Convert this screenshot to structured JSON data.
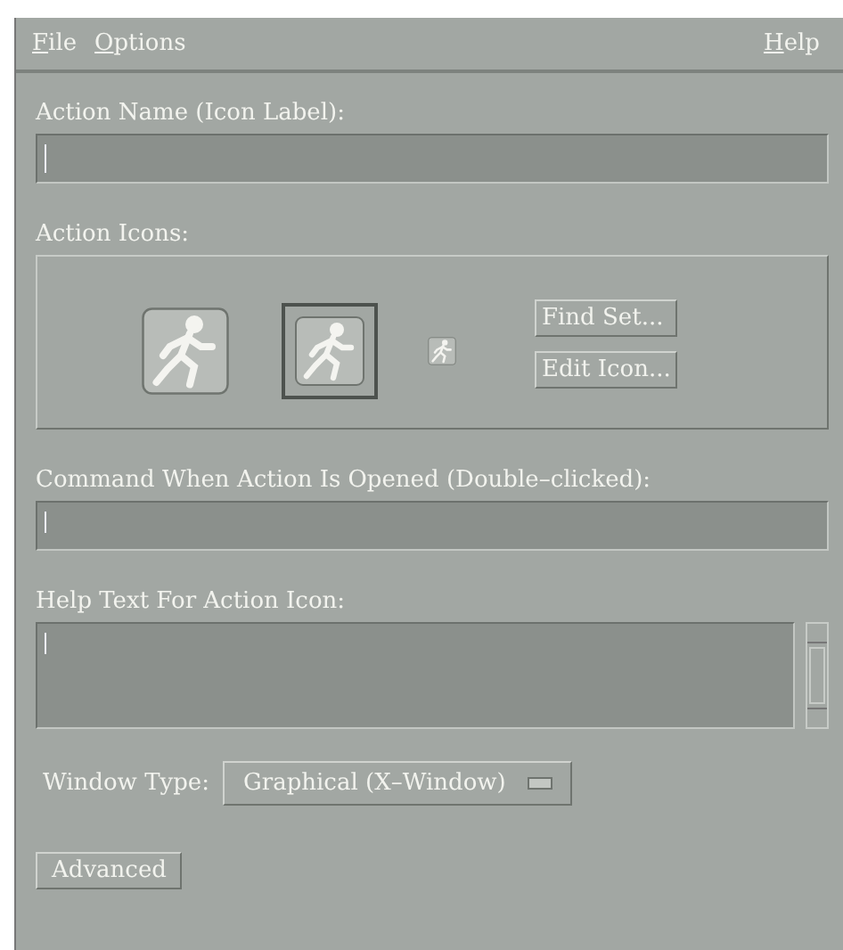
{
  "menu_bar": {
    "left": [
      "File",
      "Options"
    ],
    "right": [
      "Help"
    ]
  },
  "action_name": {
    "label": "Action Name (Icon Label):"
  },
  "action_icons": {
    "label": "Action Icons:",
    "icons": [
      {
        "kind": "large",
        "selected": false
      },
      {
        "kind": "medium",
        "selected": true
      },
      {
        "kind": "tiny",
        "selected": false
      }
    ],
    "buttons": [
      "Find Set...",
      "Edit Icon..."
    ]
  },
  "command": {
    "label": "Command When Action Is Opened (Double–clicked):"
  },
  "help_text": {
    "label": "Help Text For Action Icon:"
  },
  "window_type": {
    "label": "Window Type:",
    "value": "Graphical (X–Window)"
  },
  "buttons": [
    "Advanced"
  ]
}
